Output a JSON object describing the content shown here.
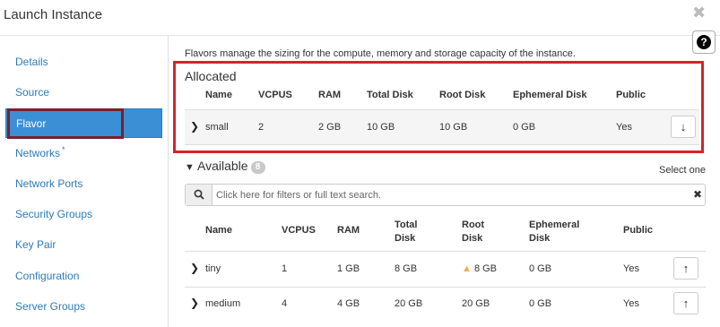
{
  "window": {
    "title": "Launch Instance"
  },
  "sidebar": {
    "items": [
      {
        "label": "Details"
      },
      {
        "label": "Source"
      },
      {
        "label": "Flavor"
      },
      {
        "label": "Networks",
        "required": "*"
      },
      {
        "label": "Network Ports"
      },
      {
        "label": "Security Groups"
      },
      {
        "label": "Key Pair"
      },
      {
        "label": "Configuration"
      },
      {
        "label": "Server Groups"
      }
    ]
  },
  "intro": "Flavors manage the sizing for the compute, memory and storage capacity of the instance.",
  "allocated": {
    "title": "Allocated",
    "columns": [
      "Name",
      "VCPUS",
      "RAM",
      "Total Disk",
      "Root Disk",
      "Ephemeral Disk",
      "Public"
    ],
    "rows": [
      {
        "name": "small",
        "vcpus": "2",
        "ram": "2 GB",
        "total_disk": "10 GB",
        "root_disk": "10 GB",
        "ephemeral": "0 GB",
        "public": "Yes"
      }
    ]
  },
  "available": {
    "title": "Available",
    "count": "8",
    "select_hint": "Select one",
    "search_placeholder": "Click here for filters or full text search.",
    "columns": {
      "name": "Name",
      "vcpus": "VCPUS",
      "ram": "RAM",
      "total_disk_1": "Total",
      "total_disk_2": "Disk",
      "root_disk_1": "Root",
      "root_disk_2": "Disk",
      "ephemeral_1": "Ephemeral",
      "ephemeral_2": "Disk",
      "public": "Public"
    },
    "rows": [
      {
        "name": "tiny",
        "vcpus": "1",
        "ram": "1 GB",
        "total_disk": "8 GB",
        "root_disk": "8 GB",
        "root_warning": true,
        "ephemeral": "0 GB",
        "public": "Yes"
      },
      {
        "name": "medium",
        "vcpus": "4",
        "ram": "4 GB",
        "total_disk": "20 GB",
        "root_disk": "20 GB",
        "ephemeral": "0 GB",
        "public": "Yes"
      }
    ]
  },
  "icons": {
    "close": "close-icon",
    "help": "question-circle-icon",
    "expand": "chevron-right-icon",
    "collapse": "chevron-down-icon",
    "search": "search-icon",
    "clear": "clear-icon",
    "deallocate": "arrow-down-icon",
    "allocate": "arrow-up-icon",
    "warning": "warning-icon"
  },
  "colors": {
    "accent": "#3b8fd4",
    "highlight_red": "#d9222a",
    "highlight_dark": "#7a1f2e",
    "warning": "#f0ad4e"
  }
}
